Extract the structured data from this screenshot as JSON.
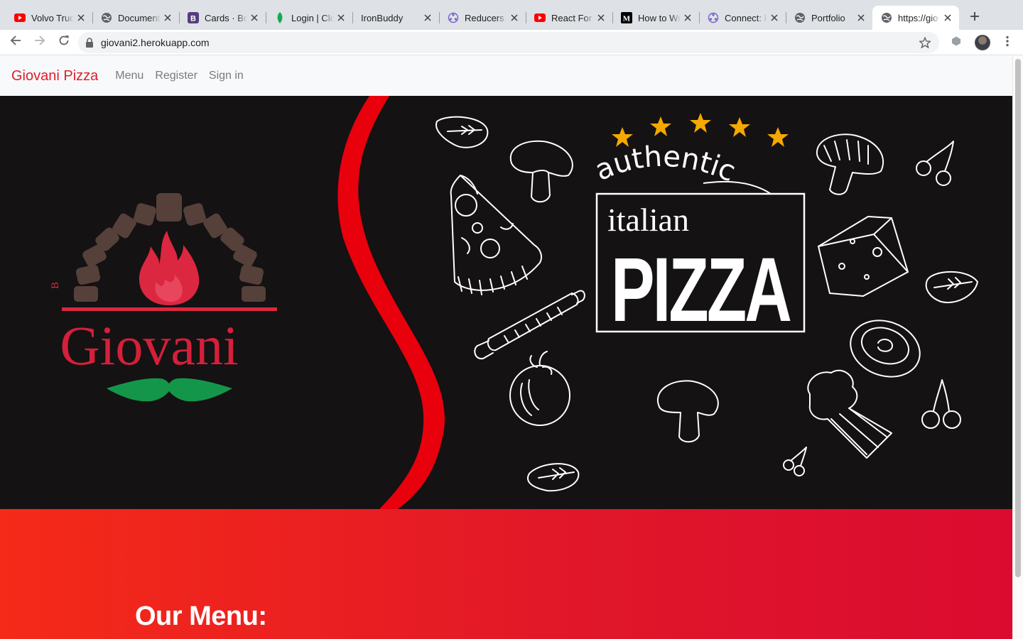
{
  "browser": {
    "tabs": [
      {
        "title": "Volvo Truc",
        "icon": "youtube-icon",
        "active": false
      },
      {
        "title": "Document",
        "icon": "globe-icon",
        "active": false
      },
      {
        "title": "Cards · Bo",
        "icon": "bootstrap-icon",
        "active": false
      },
      {
        "title": "Login | Clo",
        "icon": "leaf-icon",
        "active": false
      },
      {
        "title": "IronBuddy",
        "icon": "",
        "active": false
      },
      {
        "title": "Reducers",
        "icon": "apollo-icon",
        "active": false
      },
      {
        "title": "React For",
        "icon": "youtube-icon",
        "active": false
      },
      {
        "title": "How to Wr",
        "icon": "medium-icon",
        "active": false
      },
      {
        "title": "Connect: I",
        "icon": "apollo-icon",
        "active": false
      },
      {
        "title": "Portfolio",
        "icon": "globe-icon",
        "active": false
      },
      {
        "title": "https://gio",
        "icon": "globe-icon",
        "active": true
      }
    ],
    "url": "giovani2.herokuapp.com"
  },
  "site": {
    "brand": "Giovani Pizza",
    "nav": [
      "Menu",
      "Register",
      "Sign in"
    ]
  },
  "hero": {
    "logo_text": "Giovani",
    "logo_small": "B",
    "word_authentic": "authentic",
    "word_italian": "italian",
    "word_pizza": "PIZZA",
    "star_color": "#f5a800",
    "accent_red": "#e8000d",
    "logo_red": "#d4203a",
    "mustache_green": "#14964a",
    "oven_brick": "#56403a"
  },
  "menu_section": {
    "title": "Our Menu:"
  }
}
